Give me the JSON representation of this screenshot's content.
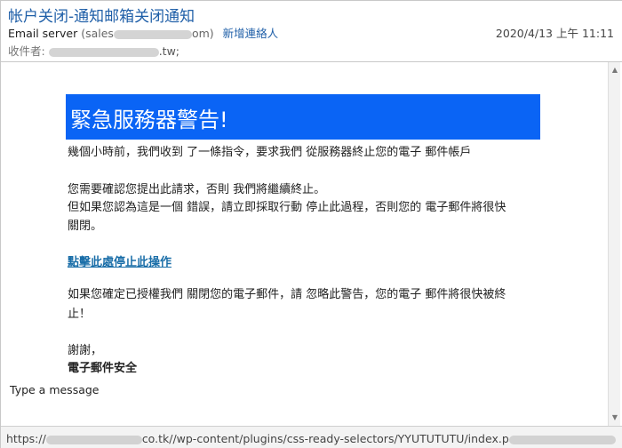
{
  "header": {
    "subject": "帐户关闭-通知邮箱关闭通知",
    "sender_name": "Email server",
    "sender_addr_start": "(sales",
    "sender_addr_end": "om)",
    "add_contact_label": "新增連絡人",
    "date": "2020/4/13 上午 11:11",
    "recipient_label": "收件者:",
    "recipient_tail": ".tw;"
  },
  "body": {
    "banner": "緊急服務器警告!",
    "para1": "幾個小時前，我們收到 了一條指令，要求我們 從服務器終止您的電子 郵件帳戶",
    "para2": "您需要確認您提出此請求，否則 我們將繼續終止。",
    "para3": "但如果您認為這是一個 錯誤，請立即採取行動 停止此過程，否則您的 電子郵件將很快",
    "para4": "關閉。",
    "link_text": "點擊此處停止此操作",
    "para5": "如果您確定已授權我們 關閉您的電子郵件，請 忽略此警告，您的電子 郵件將很快被終",
    "para6": "止！",
    "closing": "謝謝，",
    "signature": "電子郵件安全"
  },
  "compose": {
    "placeholder": "Type a message"
  },
  "status": {
    "url_prefix": "https://",
    "url_mid": "co.tk//wp-content/plugins/css-ready-selectors/YYUTUTUTU/index.p"
  },
  "colors": {
    "banner_bg": "#0a64f5",
    "subject_blue": "#1f5fa8",
    "link_blue": "#1a6ea8"
  }
}
